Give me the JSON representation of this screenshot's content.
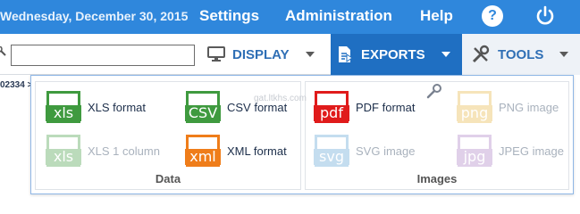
{
  "topbar": {
    "date": "Wednesday, December 30, 2015",
    "nav": [
      "Settings",
      "Administration",
      "Help"
    ],
    "help_icon": "question-icon",
    "power_icon": "power-icon"
  },
  "toolbar": {
    "search_value": "",
    "display_label": "DISPLAY",
    "exports_label": "EXPORTS",
    "tools_label": "TOOLS"
  },
  "crumb": "02334 >",
  "watermark": "gat.ltkhs.com",
  "panel": {
    "data": {
      "title": "Data",
      "items": [
        {
          "label": "XLS format",
          "icon": "xls",
          "enabled": true
        },
        {
          "label": "CSV format",
          "icon": "csv",
          "enabled": true
        },
        {
          "label": "XLS 1 column",
          "icon": "xls",
          "enabled": false
        },
        {
          "label": "XML format",
          "icon": "xml",
          "enabled": true
        }
      ]
    },
    "images": {
      "title": "Images",
      "items": [
        {
          "label": "PDF format",
          "icon": "pdf",
          "enabled": true
        },
        {
          "label": "PNG image",
          "icon": "png",
          "enabled": false
        },
        {
          "label": "SVG image",
          "icon": "svg",
          "enabled": false
        },
        {
          "label": "JPEG image",
          "icon": "jpg",
          "enabled": false
        }
      ]
    }
  },
  "colors": {
    "topbar": "#2f87dc",
    "exports_bg": "#1f6fc2",
    "xls": "#3f9a3f",
    "csv": "#3f9a3f",
    "xml": "#ef7d1a",
    "pdf": "#e01b1b",
    "png": "#e8b43c",
    "svg": "#5aa0d4",
    "jpg": "#a77cc1"
  }
}
